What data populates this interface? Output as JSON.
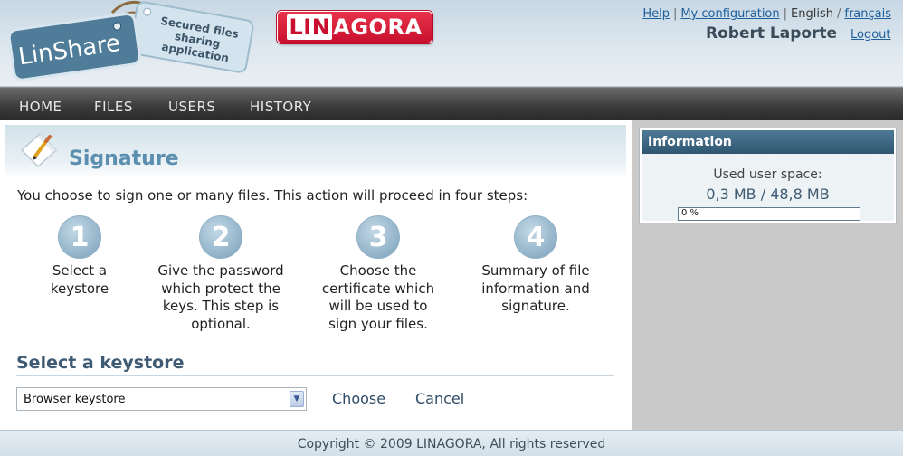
{
  "header": {
    "logo": {
      "wordmark": "LinShare",
      "tagline": "Secured files sharing application"
    },
    "partner_logo": {
      "lin": "LIN",
      "agora": "AGORA"
    },
    "links": {
      "help": "Help",
      "my_configuration": "My configuration",
      "english": "English",
      "francais": "français"
    },
    "user_name": "Robert Laporte",
    "logout": "Logout"
  },
  "nav": {
    "items": [
      {
        "label": "HOME"
      },
      {
        "label": "FILES"
      },
      {
        "label": "USERS"
      },
      {
        "label": "HISTORY"
      }
    ]
  },
  "main": {
    "title": "Signature",
    "intro": "You choose to sign one or many files. This action will proceed in four steps:",
    "steps": [
      {
        "number": "1",
        "text": "Select a keystore"
      },
      {
        "number": "2",
        "text": "Give the password which protect the keys. This step is optional."
      },
      {
        "number": "3",
        "text": "Choose the certificate which will be used to sign your files."
      },
      {
        "number": "4",
        "text": "Summary of file information and signature."
      }
    ],
    "section_title": "Select a keystore",
    "keystore_select": {
      "selected": "Browser keystore"
    },
    "choose_label": "Choose",
    "cancel_label": "Cancel"
  },
  "sidebar": {
    "info_title": "Information",
    "used_space_label": "Used user space:",
    "used_space_value": "0,3 MB / 48,8 MB",
    "progress": {
      "text": "0 %",
      "percent": 0
    }
  },
  "footer": {
    "copyright": "Copyright © 2009 LINAGORA, All rights reserved"
  },
  "colors": {
    "nav_bg": "#3d3d3d",
    "accent_blue": "#5b8fb0",
    "info_header": "#2f5670",
    "linagora_red": "#c8102e",
    "link": "#1d5e9c"
  }
}
